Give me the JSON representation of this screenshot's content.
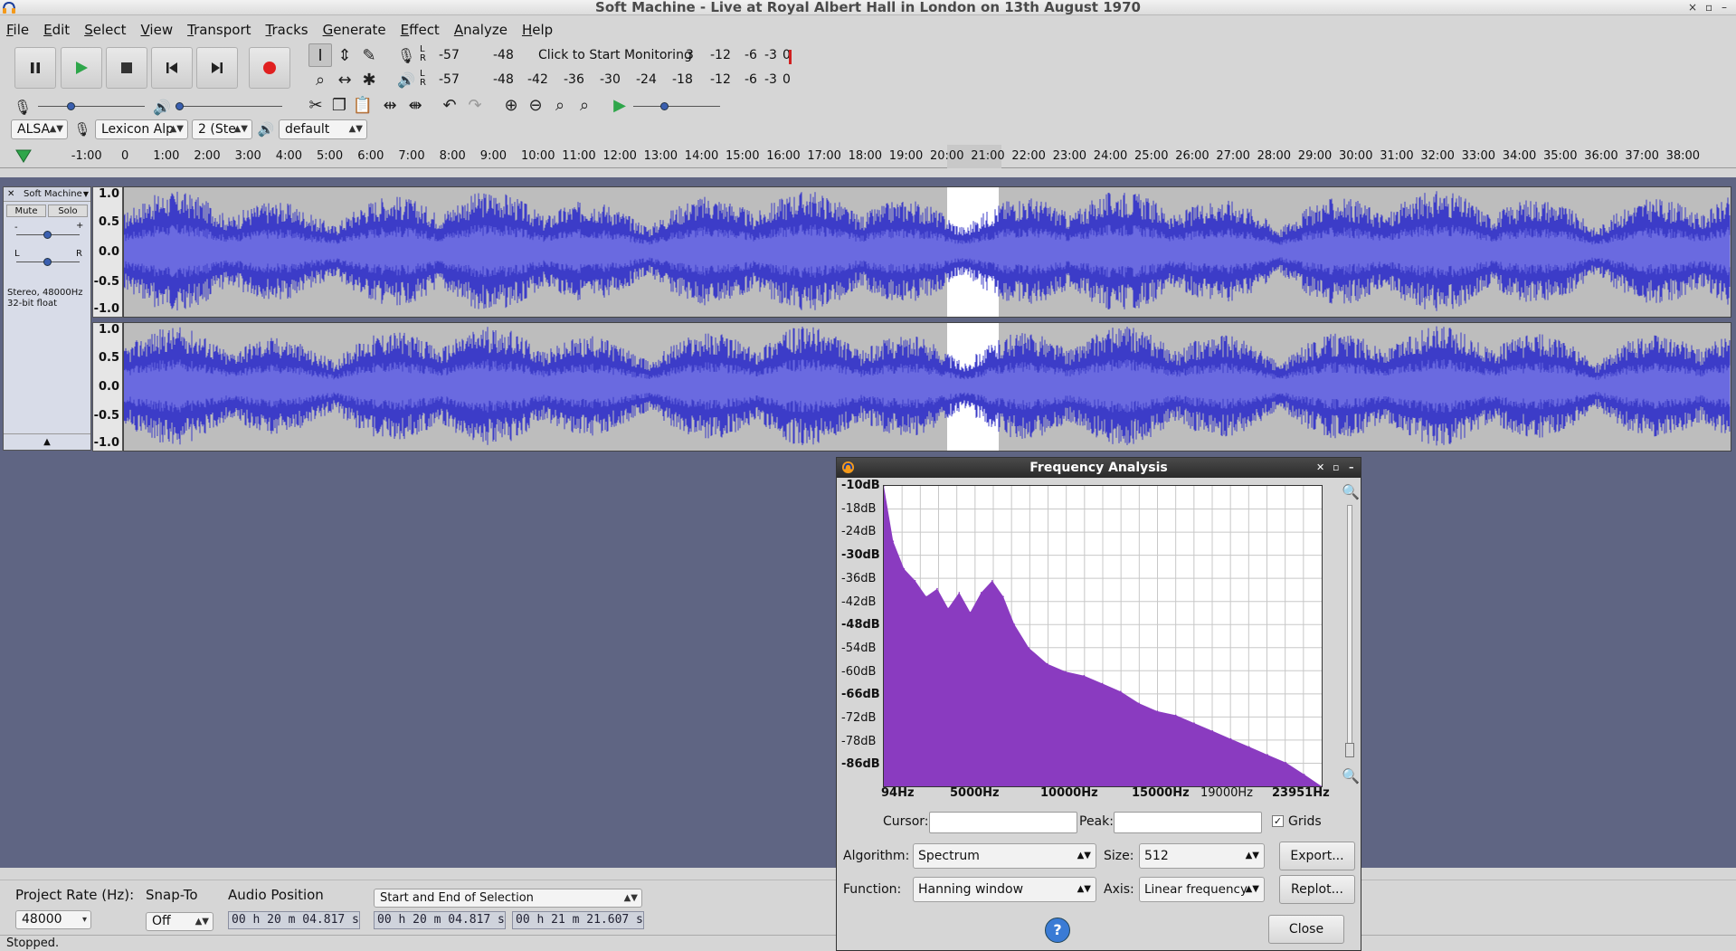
{
  "window": {
    "title": "Soft Machine - Live at Royal Albert Hall in London on 13th August 1970",
    "controls": [
      "×",
      "▫",
      "–"
    ]
  },
  "menu": [
    "File",
    "Edit",
    "Select",
    "View",
    "Transport",
    "Tracks",
    "Generate",
    "Effect",
    "Analyze",
    "Help"
  ],
  "meters": {
    "record_ticks": [
      "-57",
      "-48",
      "3",
      "-12",
      "-6",
      "-3",
      "0"
    ],
    "monitor_text": "Click to Start Monitoring",
    "playback_ticks": [
      "-57",
      "-48",
      "-42",
      "-36",
      "-30",
      "-24",
      "-18",
      "-12",
      "-6",
      "-3",
      "0"
    ]
  },
  "device": {
    "host": "ALSA",
    "input": "Lexicon Alp",
    "channels": "2 (Ste",
    "output": "default"
  },
  "ruler": {
    "labels": [
      "-1:00",
      "0",
      "1:00",
      "2:00",
      "3:00",
      "4:00",
      "5:00",
      "6:00",
      "7:00",
      "8:00",
      "9:00",
      "10:00",
      "11:00",
      "12:00",
      "13:00",
      "14:00",
      "15:00",
      "16:00",
      "17:00",
      "18:00",
      "19:00",
      "20:00",
      "21:00",
      "22:00",
      "23:00",
      "24:00",
      "25:00",
      "26:00",
      "27:00",
      "28:00",
      "29:00",
      "30:00",
      "31:00",
      "32:00",
      "33:00",
      "34:00",
      "35:00",
      "36:00",
      "37:00",
      "38:00"
    ]
  },
  "track": {
    "name": "Soft Machine",
    "mute": "Mute",
    "solo": "Solo",
    "gain_minus": "-",
    "gain_plus": "+",
    "pan_l": "L",
    "pan_r": "R",
    "info_line1": "Stereo, 48000Hz",
    "info_line2": "32-bit float",
    "scale": [
      "1.0",
      "0.5",
      "0.0",
      "-0.5",
      "-1.0"
    ]
  },
  "selection_toolbar": {
    "project_rate_label": "Project Rate (Hz):",
    "project_rate": "48000",
    "snap_label": "Snap-To",
    "snap_value": "Off",
    "audio_position_label": "Audio Position",
    "audio_position": "00 h 20 m 04.817 s",
    "selection_mode": "Start and End of Selection",
    "sel_start": "00 h 20 m 04.817 s",
    "sel_end": "00 h 21 m 21.607 s"
  },
  "status": "Stopped.",
  "dialog": {
    "title": "Frequency Analysis",
    "y_labels": [
      "-10dB",
      "-18dB",
      "-24dB",
      "-30dB",
      "-36dB",
      "-42dB",
      "-48dB",
      "-54dB",
      "-60dB",
      "-66dB",
      "-72dB",
      "-78dB",
      "-86dB"
    ],
    "x_labels": [
      "94Hz",
      "5000Hz",
      "10000Hz",
      "15000Hz",
      "19000Hz",
      "23951Hz"
    ],
    "cursor_label": "Cursor:",
    "peak_label": "Peak:",
    "grids_label": "Grids",
    "algorithm_label": "Algorithm:",
    "algorithm": "Spectrum",
    "size_label": "Size:",
    "size": "512",
    "export_label": "Export...",
    "function_label": "Function:",
    "function": "Hanning window",
    "axis_label": "Axis:",
    "axis": "Linear frequency",
    "replot_label": "Replot...",
    "help_label": "?",
    "close_label": "Close"
  },
  "colors": {
    "wave": "#3c3cc8",
    "wave_rms": "#6a6ae0",
    "spectrum": "#8a3bc0",
    "selection": "#ffffff",
    "track_bg": "#5f6583"
  },
  "chart_data": {
    "type": "area",
    "x": [
      94,
      600,
      1200,
      1800,
      2400,
      3000,
      3600,
      4200,
      4800,
      5400,
      6000,
      6600,
      7200,
      8000,
      9000,
      10000,
      11000,
      12000,
      13000,
      14000,
      15000,
      16000,
      17000,
      18000,
      19000,
      20000,
      21000,
      22000,
      23000,
      23951
    ],
    "values": [
      -10,
      -24,
      -31,
      -34,
      -38,
      -36,
      -41,
      -37,
      -42,
      -37,
      -34,
      -38,
      -45,
      -51,
      -55,
      -57,
      -58,
      -60,
      -62,
      -65,
      -67,
      -68,
      -70,
      -72,
      -74,
      -76,
      -78,
      -80,
      -83,
      -86
    ],
    "xlim": [
      94,
      23951
    ],
    "ylim": [
      -86,
      -10
    ],
    "grid": true
  }
}
